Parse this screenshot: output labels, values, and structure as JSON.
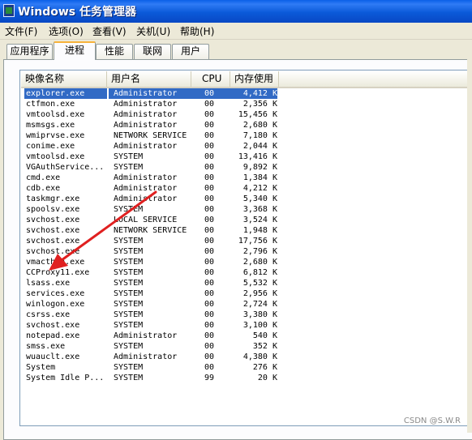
{
  "window": {
    "title": "Windows 任务管理器"
  },
  "menu": [
    "文件(F)",
    "选项(O)",
    "查看(V)",
    "关机(U)",
    "帮助(H)"
  ],
  "tabs": [
    "应用程序",
    "进程",
    "性能",
    "联网",
    "用户"
  ],
  "active_tab": "进程",
  "columns": {
    "name": "映像名称",
    "user": "用户名",
    "cpu": "CPU",
    "mem": "内存使用"
  },
  "processes": [
    {
      "name": "explorer.exe",
      "user": "Administrator",
      "cpu": "00",
      "mem": "4,412 K"
    },
    {
      "name": "ctfmon.exe",
      "user": "Administrator",
      "cpu": "00",
      "mem": "2,356 K"
    },
    {
      "name": "vmtoolsd.exe",
      "user": "Administrator",
      "cpu": "00",
      "mem": "15,456 K"
    },
    {
      "name": "msmsgs.exe",
      "user": "Administrator",
      "cpu": "00",
      "mem": "2,680 K"
    },
    {
      "name": "wmiprvse.exe",
      "user": "NETWORK SERVICE",
      "cpu": "00",
      "mem": "7,180 K"
    },
    {
      "name": "conime.exe",
      "user": "Administrator",
      "cpu": "00",
      "mem": "2,044 K"
    },
    {
      "name": "vmtoolsd.exe",
      "user": "SYSTEM",
      "cpu": "00",
      "mem": "13,416 K"
    },
    {
      "name": "VGAuthService...",
      "user": "SYSTEM",
      "cpu": "00",
      "mem": "9,892 K"
    },
    {
      "name": "cmd.exe",
      "user": "Administrator",
      "cpu": "00",
      "mem": "1,384 K"
    },
    {
      "name": "cdb.exe",
      "user": "Administrator",
      "cpu": "00",
      "mem": "4,212 K"
    },
    {
      "name": "taskmgr.exe",
      "user": "Administrator",
      "cpu": "00",
      "mem": "5,340 K"
    },
    {
      "name": "spoolsv.exe",
      "user": "SYSTEM",
      "cpu": "00",
      "mem": "3,368 K"
    },
    {
      "name": "svchost.exe",
      "user": "LOCAL SERVICE",
      "cpu": "00",
      "mem": "3,524 K"
    },
    {
      "name": "svchost.exe",
      "user": "NETWORK SERVICE",
      "cpu": "00",
      "mem": "1,948 K"
    },
    {
      "name": "svchost.exe",
      "user": "SYSTEM",
      "cpu": "00",
      "mem": "17,756 K"
    },
    {
      "name": "svchost.exe",
      "user": "SYSTEM",
      "cpu": "00",
      "mem": "2,796 K"
    },
    {
      "name": "vmacthlp.exe",
      "user": "SYSTEM",
      "cpu": "00",
      "mem": "2,680 K"
    },
    {
      "name": "CCProxy11.exe",
      "user": "SYSTEM",
      "cpu": "00",
      "mem": "6,812 K"
    },
    {
      "name": "lsass.exe",
      "user": "SYSTEM",
      "cpu": "00",
      "mem": "5,532 K"
    },
    {
      "name": "services.exe",
      "user": "SYSTEM",
      "cpu": "00",
      "mem": "2,956 K"
    },
    {
      "name": "winlogon.exe",
      "user": "SYSTEM",
      "cpu": "00",
      "mem": "2,724 K"
    },
    {
      "name": "csrss.exe",
      "user": "SYSTEM",
      "cpu": "00",
      "mem": "3,380 K"
    },
    {
      "name": "svchost.exe",
      "user": "SYSTEM",
      "cpu": "00",
      "mem": "3,100 K"
    },
    {
      "name": "notepad.exe",
      "user": "Administrator",
      "cpu": "00",
      "mem": "540 K"
    },
    {
      "name": "smss.exe",
      "user": "SYSTEM",
      "cpu": "00",
      "mem": "352 K"
    },
    {
      "name": "wuauclt.exe",
      "user": "Administrator",
      "cpu": "00",
      "mem": "4,380 K"
    },
    {
      "name": "System",
      "user": "SYSTEM",
      "cpu": "00",
      "mem": "276 K"
    },
    {
      "name": "System Idle P...",
      "user": "SYSTEM",
      "cpu": "99",
      "mem": "20 K"
    }
  ],
  "selected_process": "explorer.exe",
  "annotation": {
    "type": "arrow",
    "color": "#e02020",
    "points_to": "CCProxy11.exe"
  },
  "watermark": "CSDN @S.W.R",
  "colors": {
    "titlebar": "#0a5fe8",
    "selection": "#316ac5",
    "active_tab_accent": "#f7b33b"
  }
}
